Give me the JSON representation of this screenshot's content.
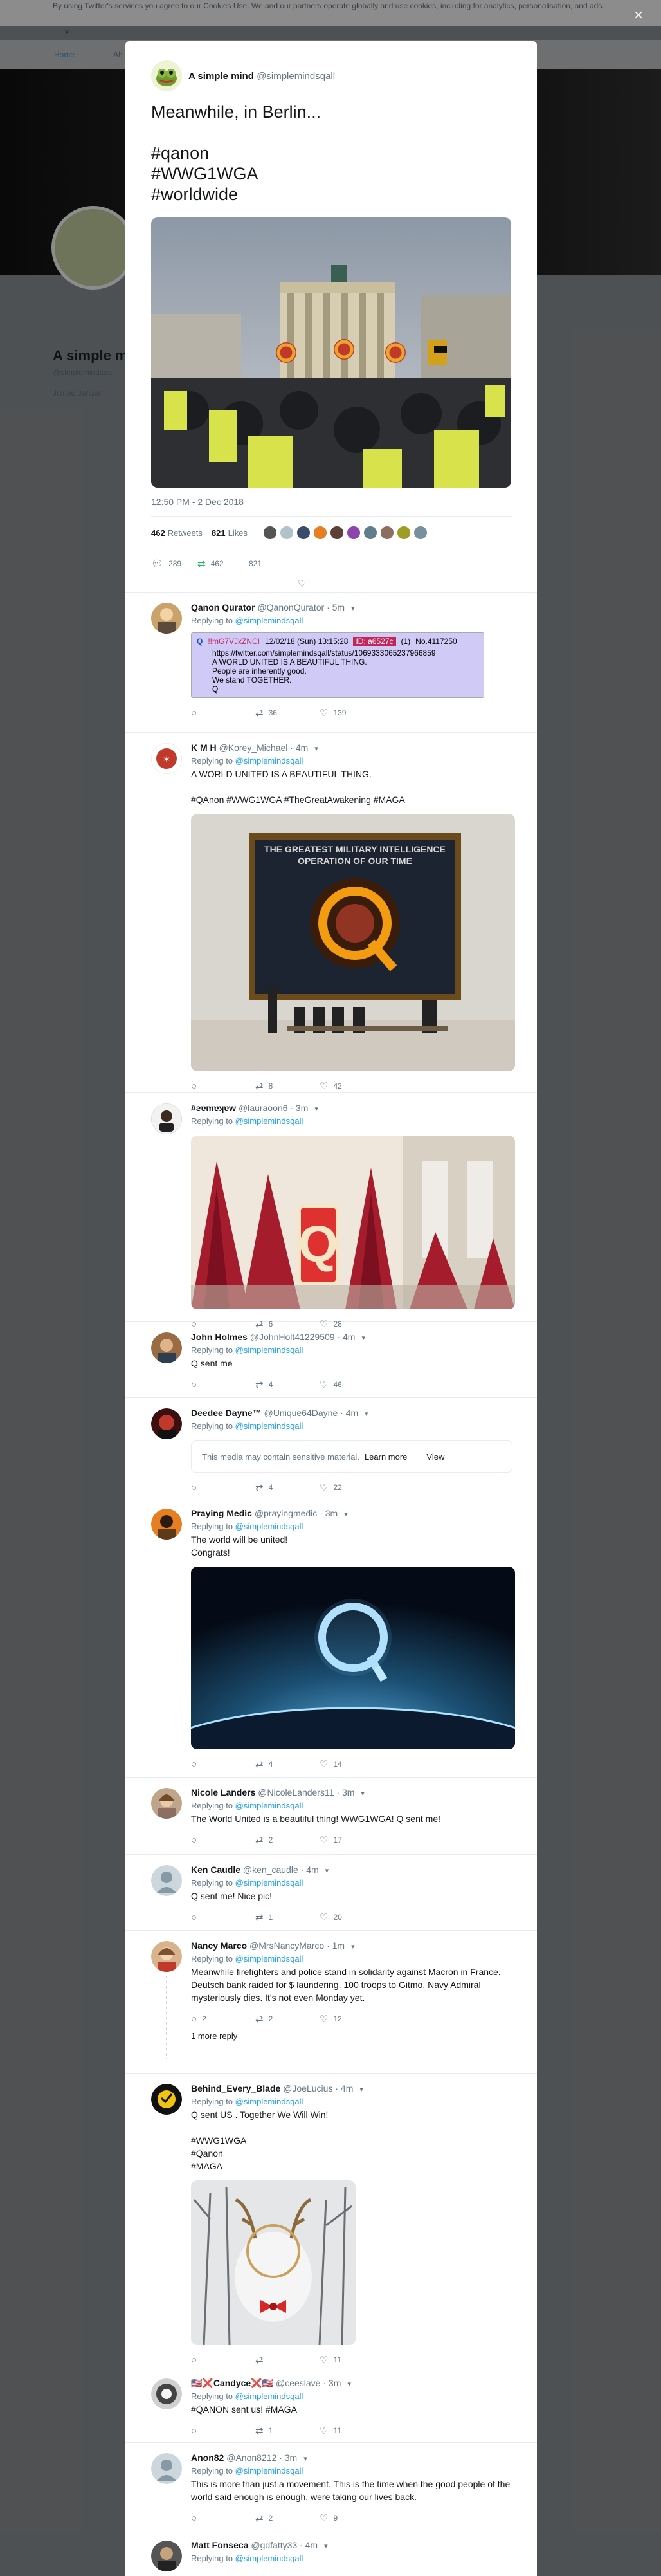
{
  "cookie": {
    "text": "By using Twitter's services you agree to our Cookies Use. We and our partners operate globally and use cookies, including for analytics, personalisation, and ads.",
    "close": "×"
  },
  "background_page": {
    "nav_home": "Home",
    "nav_about": "Ab",
    "profile_name": "A simple m",
    "profile_handle": "@simplemindsqa",
    "joined": "Joined Januar"
  },
  "modal": {
    "close": "×",
    "tweet": {
      "author": "A simple mind",
      "handle": "@simplemindsqall",
      "text": "Meanwhile, in Berlin...\n\n#qanon\n#WWG1WGA\n#worldwide",
      "timestamp": "12:50 PM - 2 Dec 2018",
      "retweets": "462",
      "retweets_label": "Retweets",
      "likes": "821",
      "likes_label": "Likes",
      "reply_count": "289",
      "retweet_count": "462",
      "like_count": "821"
    },
    "replies": [
      {
        "name": "Qanon Qurator",
        "handle": "@QanonQurator",
        "time": "5m",
        "replying_label": "Replying to",
        "replying_to": "@simplemindsqall",
        "qcard": {
          "name": "Q",
          "trip": "!!mG7VJxZNCI",
          "date": "12/02/18 (Sun) 13:15:28",
          "id": "ID: a6527c",
          "count": "(1)",
          "post_no": "No.4117250",
          "body": "https://twitter.com/simplemindsqall/status/1069333065237966859\nA WORLD UNITED IS A BEAUTIFUL THING.\nPeople are inherently good.\nWe stand TOGETHER.\nQ"
        },
        "counts": {
          "reply": "",
          "retweet": "36",
          "like": "139"
        }
      },
      {
        "name": "K M H",
        "handle": "@Korey_Michael",
        "time": "4m",
        "replying_label": "Replying to",
        "replying_to": "@simplemindsqall",
        "text": "A WORLD UNITED IS A BEAUTIFUL THING.\n\n#QAnon #WWG1WGA #TheGreatAwakening #MAGA",
        "image_caption": "THE GREATEST MILITARY INTELLIGENCE\nOPERATION OF OUR TIME",
        "counts": {
          "reply": "",
          "retweet": "8",
          "like": "42"
        }
      },
      {
        "name": "#ƨɐmɐʞɐw",
        "handle": "@lauraoon6",
        "time": "3m",
        "replying_label": "Replying to",
        "replying_to": "@simplemindsqall",
        "counts": {
          "reply": "",
          "retweet": "6",
          "like": "28"
        }
      },
      {
        "name": "John Holmes",
        "handle": "@JohnHolt41229509",
        "time": "4m",
        "replying_label": "Replying to",
        "replying_to": "@simplemindsqall",
        "text": "Q sent me",
        "counts": {
          "reply": "",
          "retweet": "4",
          "like": "46"
        }
      },
      {
        "name": "Deedee Dayne™",
        "handle": "@Unique64Dayne",
        "time": "4m",
        "replying_label": "Replying to",
        "replying_to": "@simplemindsqall",
        "sensitive": "This media may contain sensitive material.",
        "learn_more": "Learn more",
        "view": "View",
        "counts": {
          "reply": "",
          "retweet": "4",
          "like": "22"
        }
      },
      {
        "name": "Praying Medic",
        "handle": "@prayingmedic",
        "time": "3m",
        "replying_label": "Replying to",
        "replying_to": "@simplemindsqall",
        "text": "The world will be united!\nCongrats!",
        "counts": {
          "reply": "",
          "retweet": "4",
          "like": "14"
        }
      },
      {
        "name": "Nicole Landers",
        "handle": "@NicoleLanders11",
        "time": "3m",
        "replying_label": "Replying to",
        "replying_to": "@simplemindsqall",
        "text": "The World United is a beautiful thing! WWG1WGA! Q sent me!",
        "counts": {
          "reply": "",
          "retweet": "2",
          "like": "17"
        }
      },
      {
        "name": "Ken Caudle",
        "handle": "@ken_caudle",
        "time": "4m",
        "replying_label": "Replying to",
        "replying_to": "@simplemindsqall",
        "text": "Q sent me! Nice pic!",
        "counts": {
          "reply": "",
          "retweet": "1",
          "like": "20"
        }
      },
      {
        "name": "Nancy Marco",
        "handle": "@MrsNancyMarco",
        "time": "1m",
        "replying_label": "Replying to",
        "replying_to": "@simplemindsqall",
        "text": "Meanwhile firefighters and police stand in solidarity against Macron in France. Deutsch bank raided for $ laundering. 100 troops to Gitmo. Navy Admiral mysteriously dies. It's not even Monday yet.",
        "more_replies": "1 more reply",
        "counts": {
          "reply": "2",
          "retweet": "2",
          "like": "12"
        }
      },
      {
        "name": "Behind_Every_Blade",
        "handle": "@JoeLucius",
        "time": "4m",
        "replying_label": "Replying to",
        "replying_to": "@simplemindsqall",
        "text": "Q sent US . Together We Will Win!\n\n#WWG1WGA\n#Qanon\n#MAGA",
        "counts": {
          "reply": "",
          "retweet": "",
          "like": "11"
        }
      },
      {
        "name": "🇺🇸❌Candyce❌🇺🇸",
        "handle": "@ceeslave",
        "time": "3m",
        "replying_label": "Replying to",
        "replying_to": "@simplemindsqall",
        "text": "#QANON sent us! #MAGA",
        "counts": {
          "reply": "",
          "retweet": "1",
          "like": "11"
        }
      },
      {
        "name": "Anon82",
        "handle": "@Anon8212",
        "time": "3m",
        "replying_label": "Replying to",
        "replying_to": "@simplemindsqall",
        "text": "This is more than just a movement. This is the time when the good people of the world said enough is enough, were taking our lives back.",
        "counts": {
          "reply": "",
          "retweet": "2",
          "like": "9"
        }
      },
      {
        "name": "Matt Fonseca",
        "handle": "@gdfatty33",
        "time": "4m",
        "replying_label": "Replying to",
        "replying_to": "@simplemindsqall"
      }
    ]
  }
}
